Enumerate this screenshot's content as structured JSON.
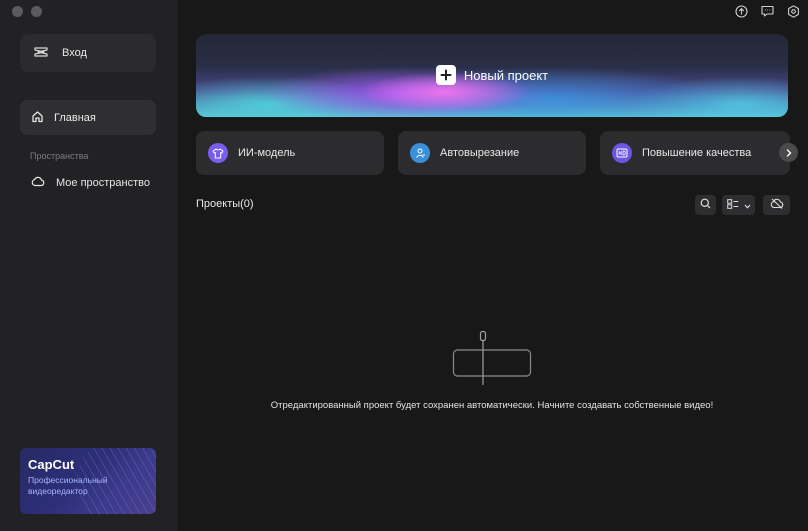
{
  "window": {
    "controls": [
      "close",
      "minimize"
    ]
  },
  "sidebar": {
    "login_label": "Вход",
    "home_label": "Главная",
    "section_label": "Пространства",
    "my_space_label": "Мое пространство",
    "promo": {
      "brand": "CapCut",
      "subtitle": "Профессиональный видеоредактор"
    }
  },
  "topbar": {
    "icons": [
      "upload-icon",
      "feedback-icon",
      "settings-icon"
    ]
  },
  "hero": {
    "label": "Новый проект"
  },
  "tools": [
    {
      "label": "ИИ-модель",
      "icon": "shirt-icon",
      "color": "#7b5cf0"
    },
    {
      "label": "Автовырезание",
      "icon": "person-cutout-icon",
      "color": "#3a8fd9"
    },
    {
      "label": "Повышение качества",
      "icon": "hd-icon",
      "color": "#6e55e0"
    }
  ],
  "projects": {
    "title": "Проекты",
    "count": "(0)",
    "empty_message": "Отредактированный проект будет сохранен автоматически. Начните создавать собственные видео!"
  },
  "colors": {
    "background": "#181818",
    "sidebar": "#222224",
    "card": "#2c2c2f"
  }
}
